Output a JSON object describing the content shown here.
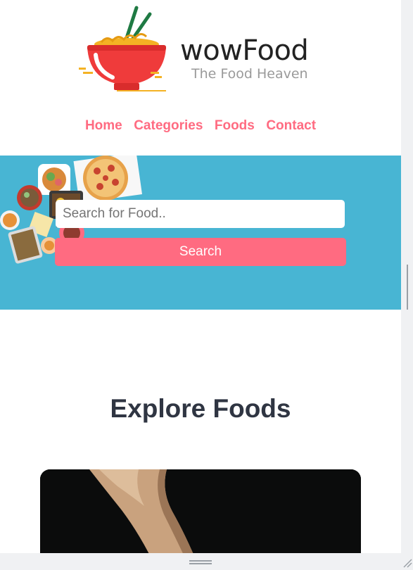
{
  "logo": {
    "brand": "wowFood",
    "tagline": "The Food Heaven",
    "icon": "food-bowl-with-chopsticks"
  },
  "nav": {
    "items": [
      {
        "label": "Home"
      },
      {
        "label": "Categories"
      },
      {
        "label": "Foods"
      },
      {
        "label": "Contact"
      }
    ]
  },
  "search": {
    "placeholder": "Search for Food..",
    "value": "",
    "button_label": "Search"
  },
  "explore": {
    "title": "Explore Foods"
  },
  "colors": {
    "accent": "#ff6b81",
    "hero_bg": "#48b5d3",
    "heading": "#2f3542"
  }
}
